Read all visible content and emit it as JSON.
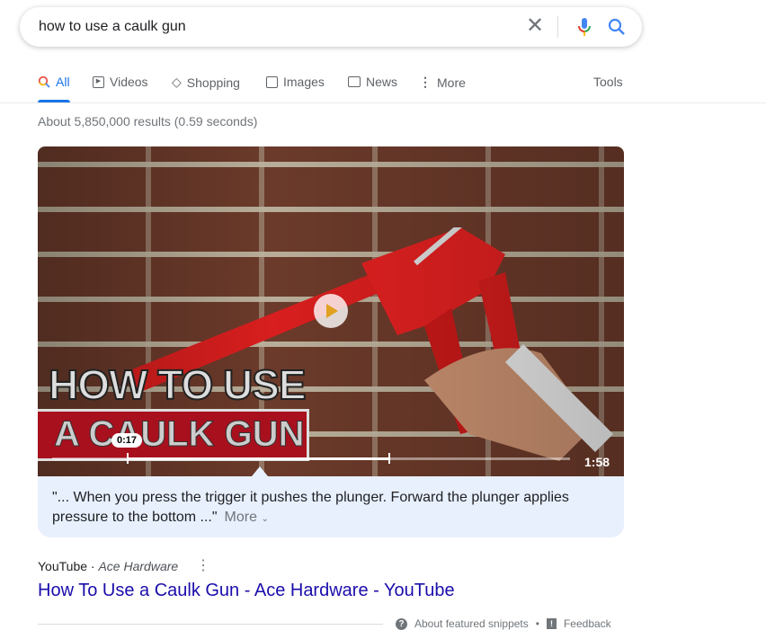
{
  "search": {
    "query": "how to use a caulk gun",
    "clear_icon": "close-icon",
    "mic_icon": "mic-icon",
    "search_icon": "search-icon"
  },
  "tabs": [
    {
      "label": "All",
      "icon": "search-icon",
      "active": true
    },
    {
      "label": "Videos",
      "icon": "play-icon"
    },
    {
      "label": "Shopping",
      "icon": "tag-icon"
    },
    {
      "label": "Images",
      "icon": "image-icon"
    },
    {
      "label": "News",
      "icon": "news-icon"
    },
    {
      "label": "More",
      "icon": "more-vert-icon"
    }
  ],
  "tools_label": "Tools",
  "stats": "About 5,850,000 results (0.59 seconds)",
  "video": {
    "thumb_line1": "HOW TO USE",
    "thumb_line2": "A CAULK GUN",
    "timestamp": "0:17",
    "duration": "1:58",
    "progress_start": 0.147,
    "progress_end": 0.652
  },
  "snippet": {
    "text": "\"... When you press the trigger it pushes the plunger. Forward the plunger applies pressure to the bottom ...\"",
    "more_label": "More"
  },
  "result": {
    "source": "YouTube",
    "author": "Ace Hardware",
    "title": "How To Use a Caulk Gun - Ace Hardware - YouTube"
  },
  "footer": {
    "about": "About featured snippets",
    "feedback": "Feedback"
  },
  "colors": {
    "link": "#1a0dab",
    "accent": "#1a73e8",
    "snippet_bg": "#e8f0fe"
  }
}
